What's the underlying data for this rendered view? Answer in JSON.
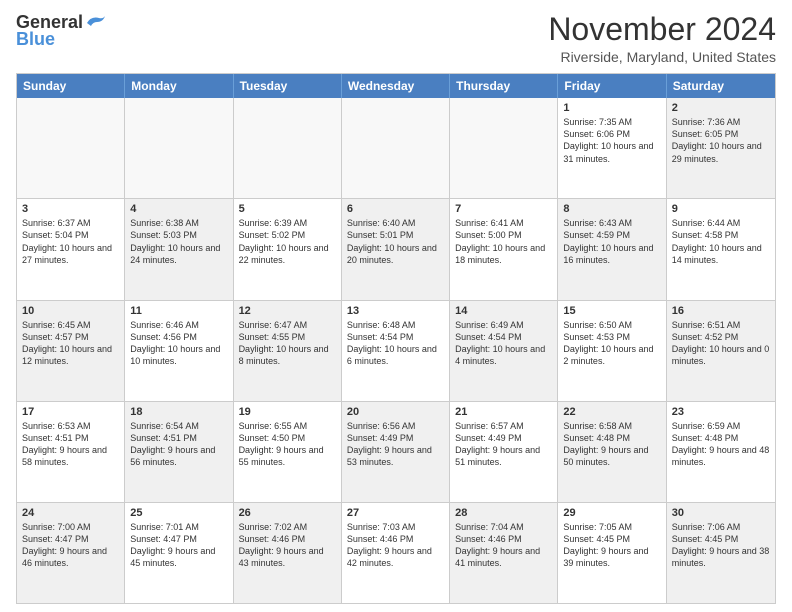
{
  "header": {
    "logo_general": "General",
    "logo_blue": "Blue",
    "month_title": "November 2024",
    "location": "Riverside, Maryland, United States"
  },
  "weekdays": [
    "Sunday",
    "Monday",
    "Tuesday",
    "Wednesday",
    "Thursday",
    "Friday",
    "Saturday"
  ],
  "rows": [
    [
      {
        "day": "",
        "info": "",
        "empty": true
      },
      {
        "day": "",
        "info": "",
        "empty": true
      },
      {
        "day": "",
        "info": "",
        "empty": true
      },
      {
        "day": "",
        "info": "",
        "empty": true
      },
      {
        "day": "",
        "info": "",
        "empty": true
      },
      {
        "day": "1",
        "info": "Sunrise: 7:35 AM\nSunset: 6:06 PM\nDaylight: 10 hours\nand 31 minutes.",
        "empty": false,
        "shaded": false
      },
      {
        "day": "2",
        "info": "Sunrise: 7:36 AM\nSunset: 6:05 PM\nDaylight: 10 hours\nand 29 minutes.",
        "empty": false,
        "shaded": true
      }
    ],
    [
      {
        "day": "3",
        "info": "Sunrise: 6:37 AM\nSunset: 5:04 PM\nDaylight: 10 hours\nand 27 minutes.",
        "empty": false,
        "shaded": false
      },
      {
        "day": "4",
        "info": "Sunrise: 6:38 AM\nSunset: 5:03 PM\nDaylight: 10 hours\nand 24 minutes.",
        "empty": false,
        "shaded": true
      },
      {
        "day": "5",
        "info": "Sunrise: 6:39 AM\nSunset: 5:02 PM\nDaylight: 10 hours\nand 22 minutes.",
        "empty": false,
        "shaded": false
      },
      {
        "day": "6",
        "info": "Sunrise: 6:40 AM\nSunset: 5:01 PM\nDaylight: 10 hours\nand 20 minutes.",
        "empty": false,
        "shaded": true
      },
      {
        "day": "7",
        "info": "Sunrise: 6:41 AM\nSunset: 5:00 PM\nDaylight: 10 hours\nand 18 minutes.",
        "empty": false,
        "shaded": false
      },
      {
        "day": "8",
        "info": "Sunrise: 6:43 AM\nSunset: 4:59 PM\nDaylight: 10 hours\nand 16 minutes.",
        "empty": false,
        "shaded": true
      },
      {
        "day": "9",
        "info": "Sunrise: 6:44 AM\nSunset: 4:58 PM\nDaylight: 10 hours\nand 14 minutes.",
        "empty": false,
        "shaded": false
      }
    ],
    [
      {
        "day": "10",
        "info": "Sunrise: 6:45 AM\nSunset: 4:57 PM\nDaylight: 10 hours\nand 12 minutes.",
        "empty": false,
        "shaded": true
      },
      {
        "day": "11",
        "info": "Sunrise: 6:46 AM\nSunset: 4:56 PM\nDaylight: 10 hours\nand 10 minutes.",
        "empty": false,
        "shaded": false
      },
      {
        "day": "12",
        "info": "Sunrise: 6:47 AM\nSunset: 4:55 PM\nDaylight: 10 hours\nand 8 minutes.",
        "empty": false,
        "shaded": true
      },
      {
        "day": "13",
        "info": "Sunrise: 6:48 AM\nSunset: 4:54 PM\nDaylight: 10 hours\nand 6 minutes.",
        "empty": false,
        "shaded": false
      },
      {
        "day": "14",
        "info": "Sunrise: 6:49 AM\nSunset: 4:54 PM\nDaylight: 10 hours\nand 4 minutes.",
        "empty": false,
        "shaded": true
      },
      {
        "day": "15",
        "info": "Sunrise: 6:50 AM\nSunset: 4:53 PM\nDaylight: 10 hours\nand 2 minutes.",
        "empty": false,
        "shaded": false
      },
      {
        "day": "16",
        "info": "Sunrise: 6:51 AM\nSunset: 4:52 PM\nDaylight: 10 hours\nand 0 minutes.",
        "empty": false,
        "shaded": true
      }
    ],
    [
      {
        "day": "17",
        "info": "Sunrise: 6:53 AM\nSunset: 4:51 PM\nDaylight: 9 hours\nand 58 minutes.",
        "empty": false,
        "shaded": false
      },
      {
        "day": "18",
        "info": "Sunrise: 6:54 AM\nSunset: 4:51 PM\nDaylight: 9 hours\nand 56 minutes.",
        "empty": false,
        "shaded": true
      },
      {
        "day": "19",
        "info": "Sunrise: 6:55 AM\nSunset: 4:50 PM\nDaylight: 9 hours\nand 55 minutes.",
        "empty": false,
        "shaded": false
      },
      {
        "day": "20",
        "info": "Sunrise: 6:56 AM\nSunset: 4:49 PM\nDaylight: 9 hours\nand 53 minutes.",
        "empty": false,
        "shaded": true
      },
      {
        "day": "21",
        "info": "Sunrise: 6:57 AM\nSunset: 4:49 PM\nDaylight: 9 hours\nand 51 minutes.",
        "empty": false,
        "shaded": false
      },
      {
        "day": "22",
        "info": "Sunrise: 6:58 AM\nSunset: 4:48 PM\nDaylight: 9 hours\nand 50 minutes.",
        "empty": false,
        "shaded": true
      },
      {
        "day": "23",
        "info": "Sunrise: 6:59 AM\nSunset: 4:48 PM\nDaylight: 9 hours\nand 48 minutes.",
        "empty": false,
        "shaded": false
      }
    ],
    [
      {
        "day": "24",
        "info": "Sunrise: 7:00 AM\nSunset: 4:47 PM\nDaylight: 9 hours\nand 46 minutes.",
        "empty": false,
        "shaded": true
      },
      {
        "day": "25",
        "info": "Sunrise: 7:01 AM\nSunset: 4:47 PM\nDaylight: 9 hours\nand 45 minutes.",
        "empty": false,
        "shaded": false
      },
      {
        "day": "26",
        "info": "Sunrise: 7:02 AM\nSunset: 4:46 PM\nDaylight: 9 hours\nand 43 minutes.",
        "empty": false,
        "shaded": true
      },
      {
        "day": "27",
        "info": "Sunrise: 7:03 AM\nSunset: 4:46 PM\nDaylight: 9 hours\nand 42 minutes.",
        "empty": false,
        "shaded": false
      },
      {
        "day": "28",
        "info": "Sunrise: 7:04 AM\nSunset: 4:46 PM\nDaylight: 9 hours\nand 41 minutes.",
        "empty": false,
        "shaded": true
      },
      {
        "day": "29",
        "info": "Sunrise: 7:05 AM\nSunset: 4:45 PM\nDaylight: 9 hours\nand 39 minutes.",
        "empty": false,
        "shaded": false
      },
      {
        "day": "30",
        "info": "Sunrise: 7:06 AM\nSunset: 4:45 PM\nDaylight: 9 hours\nand 38 minutes.",
        "empty": false,
        "shaded": true
      }
    ]
  ]
}
